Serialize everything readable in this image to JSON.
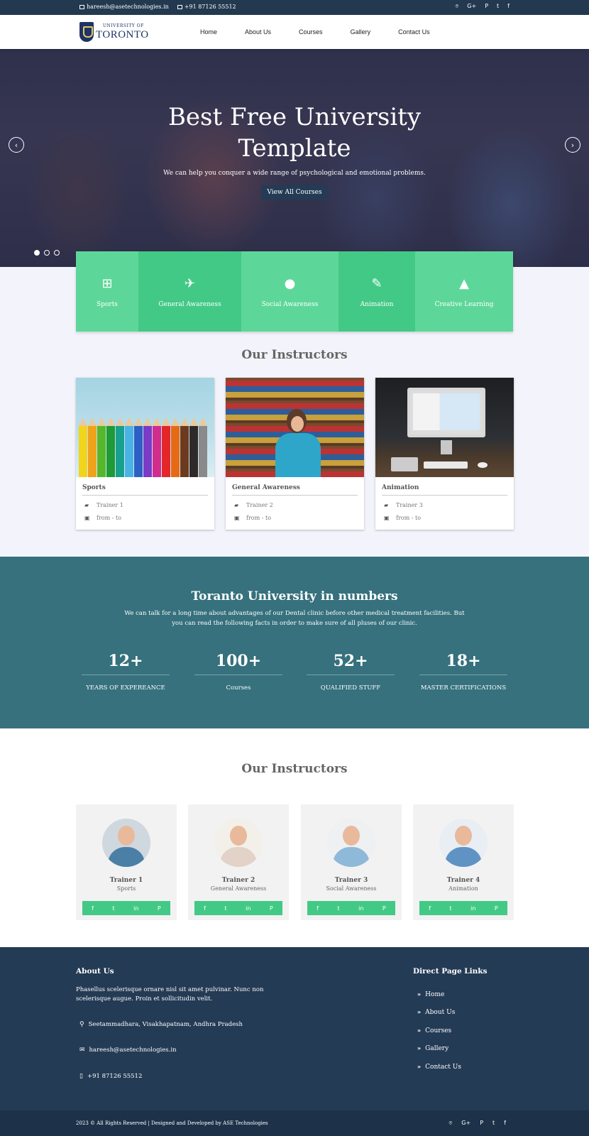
{
  "topbar": {
    "email": "hareesh@asetechnologies.in",
    "phone": "+91 87126 55512",
    "social": [
      "⌾",
      "G+",
      "P",
      "t",
      "f"
    ]
  },
  "nav": {
    "logo_small": "UNIVERSITY OF",
    "logo_big": "TORONTO",
    "links": [
      "Home",
      "About Us",
      "Courses",
      "Gallery",
      "Contact Us"
    ]
  },
  "hero": {
    "title_line1": "Best Free University",
    "title_line2": "Template",
    "subtitle": "We can help you conquer a wide range of psychological and emotional problems.",
    "button": "View All Courses",
    "prev_icon": "‹",
    "next_icon": "›"
  },
  "categories": [
    {
      "label": "Sports",
      "icon": "sitemap-icon",
      "glyph": "⊞"
    },
    {
      "label": "General Awareness",
      "icon": "space-shuttle-icon",
      "glyph": "✈"
    },
    {
      "label": "Social Awareness",
      "icon": "globe-icon",
      "glyph": "●"
    },
    {
      "label": "Animation",
      "icon": "feather-icon",
      "glyph": "✎"
    },
    {
      "label": "Creative Learning",
      "icon": "app-store-icon",
      "glyph": "▲"
    }
  ],
  "courses_title": "Our Instructors",
  "courses": [
    {
      "title": "Sports",
      "trainer": "Trainer 1",
      "date": "from - to"
    },
    {
      "title": "General Awareness",
      "trainer": "Trainer 2",
      "date": "from - to"
    },
    {
      "title": "Animation",
      "trainer": "Trainer 3",
      "date": "from - to"
    }
  ],
  "numbers": {
    "title": "Toranto University in numbers",
    "desc": "We can talk for a long time about advantages of our Dental clinic before other medical treatment facilities. But you can read the following facts in order to make sure of all pluses of our clinic.",
    "stats": [
      {
        "num": "12+",
        "label": "YEARS OF EXPEREANCE"
      },
      {
        "num": "100+",
        "label": "Courses"
      },
      {
        "num": "52+",
        "label": "QUALIFIED STUFF"
      },
      {
        "num": "18+",
        "label": "MASTER CERTIFICATIONS"
      }
    ]
  },
  "trainers_title": "Our Instructors",
  "trainers": [
    {
      "name": "Trainer 1",
      "spec": "Sports",
      "shirt": "#4b7fa6"
    },
    {
      "name": "Trainer 2",
      "spec": "General Awareness",
      "shirt": "#e2d2c8"
    },
    {
      "name": "Trainer 3",
      "spec": "Social Awareness",
      "shirt": "#8fb9d9"
    },
    {
      "name": "Trainer 4",
      "spec": "Animation",
      "shirt": "#5f93c4"
    }
  ],
  "trainer_social": [
    "f",
    "t",
    "in",
    "P"
  ],
  "footer": {
    "about_title": "About Us",
    "about_text": "Phasellus scelerisque ornare nisl sit amet pulvinar. Nunc non scelerisque augue. Proin et sollicitudin velit.",
    "address": "Seetammadhara, Visakhapatnam, Andhra Pradesh",
    "email": "hareesh@asetechnologies.in",
    "phone": "+91 87126 55512",
    "links_title": "Direct Page Links",
    "links": [
      "Home",
      "About Us",
      "Courses",
      "Gallery",
      "Contact Us"
    ],
    "copyright": "2023 © All Rights Reserved | Designed and Developed by ASE Technologies"
  },
  "colors": {
    "green_light": "#5dd799",
    "green_dark": "#43c986",
    "navy": "#243b55",
    "teal": "#36717d"
  }
}
